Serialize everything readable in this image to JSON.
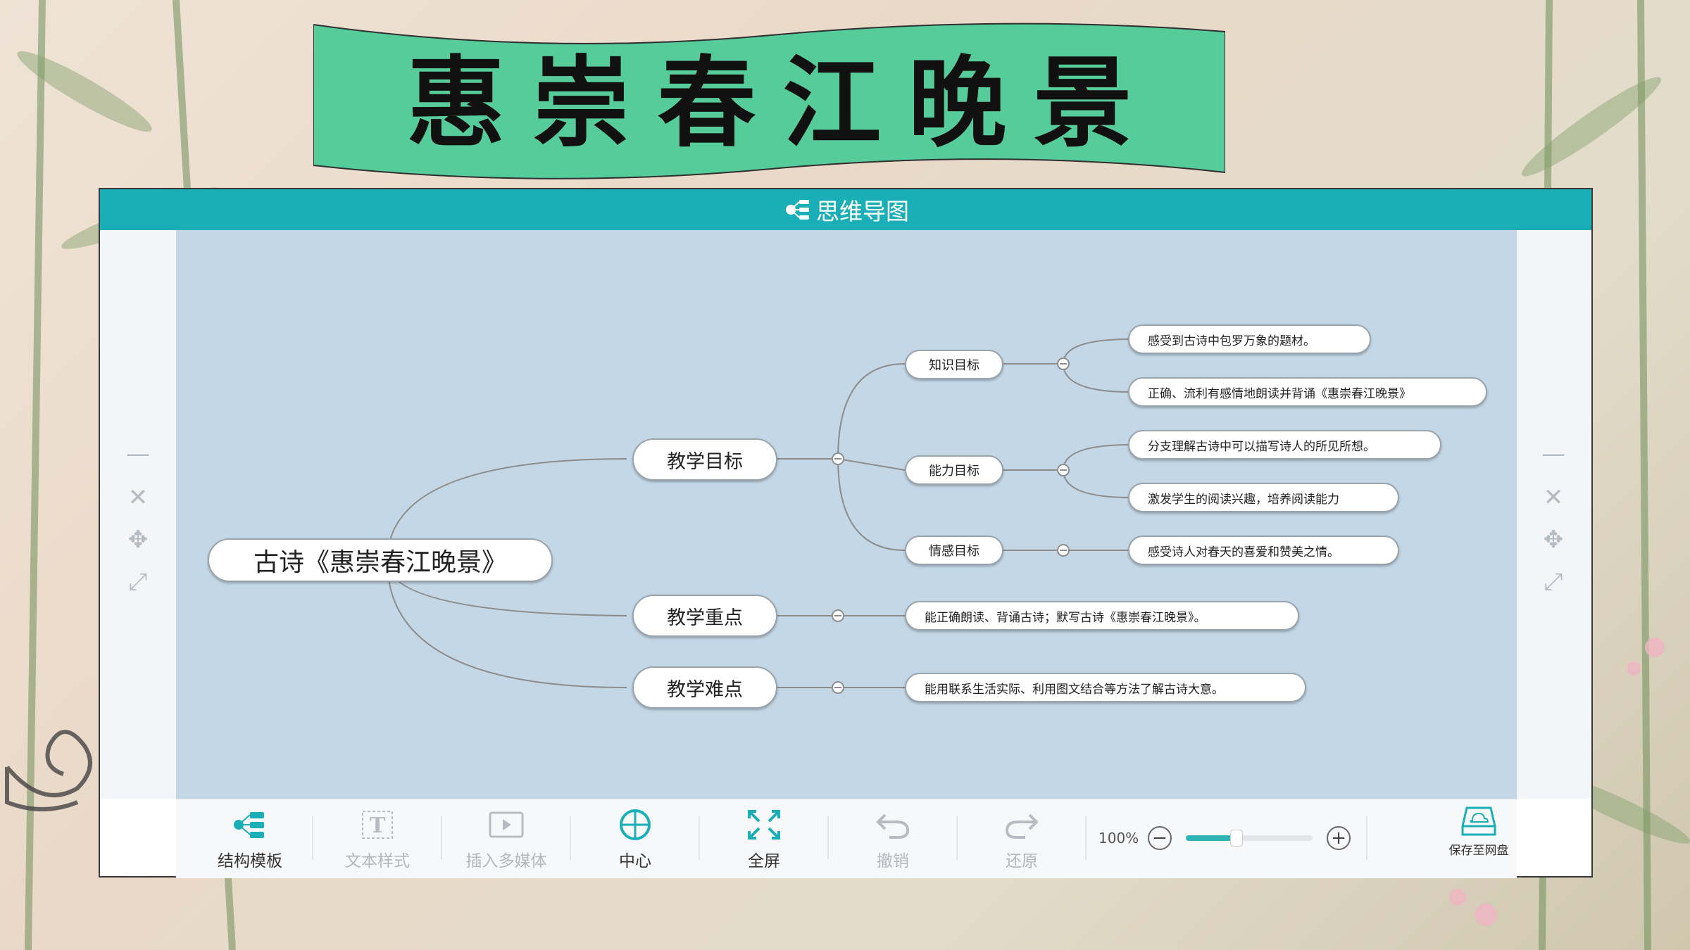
{
  "banner": {
    "title": "惠崇春江晚景"
  },
  "app": {
    "title": "思维导图"
  },
  "mindmap": {
    "root": "古诗《惠崇春江晚景》",
    "branches": [
      {
        "label": "教学目标",
        "children": [
          {
            "label": "知识目标",
            "leaves": [
              "感受到古诗中包罗万象的题材。",
              "正确、流利有感情地朗读并背诵《惠崇春江晚景》"
            ]
          },
          {
            "label": "能力目标",
            "leaves": [
              "分支理解古诗中可以描写诗人的所见所想。",
              "激发学生的阅读兴趣，培养阅读能力"
            ]
          },
          {
            "label": "情感目标",
            "leaves": [
              "感受诗人对春天的喜爱和赞美之情。"
            ]
          }
        ]
      },
      {
        "label": "教学重点",
        "leaves": [
          "能正确朗读、背诵古诗；默写古诗《惠崇春江晚景》。"
        ]
      },
      {
        "label": "教学难点",
        "leaves": [
          "能用联系生活实际、利用图文结合等方法了解古诗大意。"
        ]
      }
    ]
  },
  "toolbar": {
    "structure": "结构模板",
    "text_style": "文本样式",
    "insert_media": "插入多媒体",
    "center": "中心",
    "fullscreen": "全屏",
    "undo": "撤销",
    "redo": "还原",
    "zoom": "100%",
    "zoom_level": 0.4,
    "save": "保存至网盘"
  },
  "colors": {
    "titlebar": "#1aaeb7",
    "canvas": "#c3d7e6",
    "banner": "#56cc9b",
    "slider": "#2eb5b5"
  },
  "icons": {
    "side": [
      "minimize-icon",
      "close-icon",
      "move-icon",
      "fit-screen-icon"
    ]
  }
}
